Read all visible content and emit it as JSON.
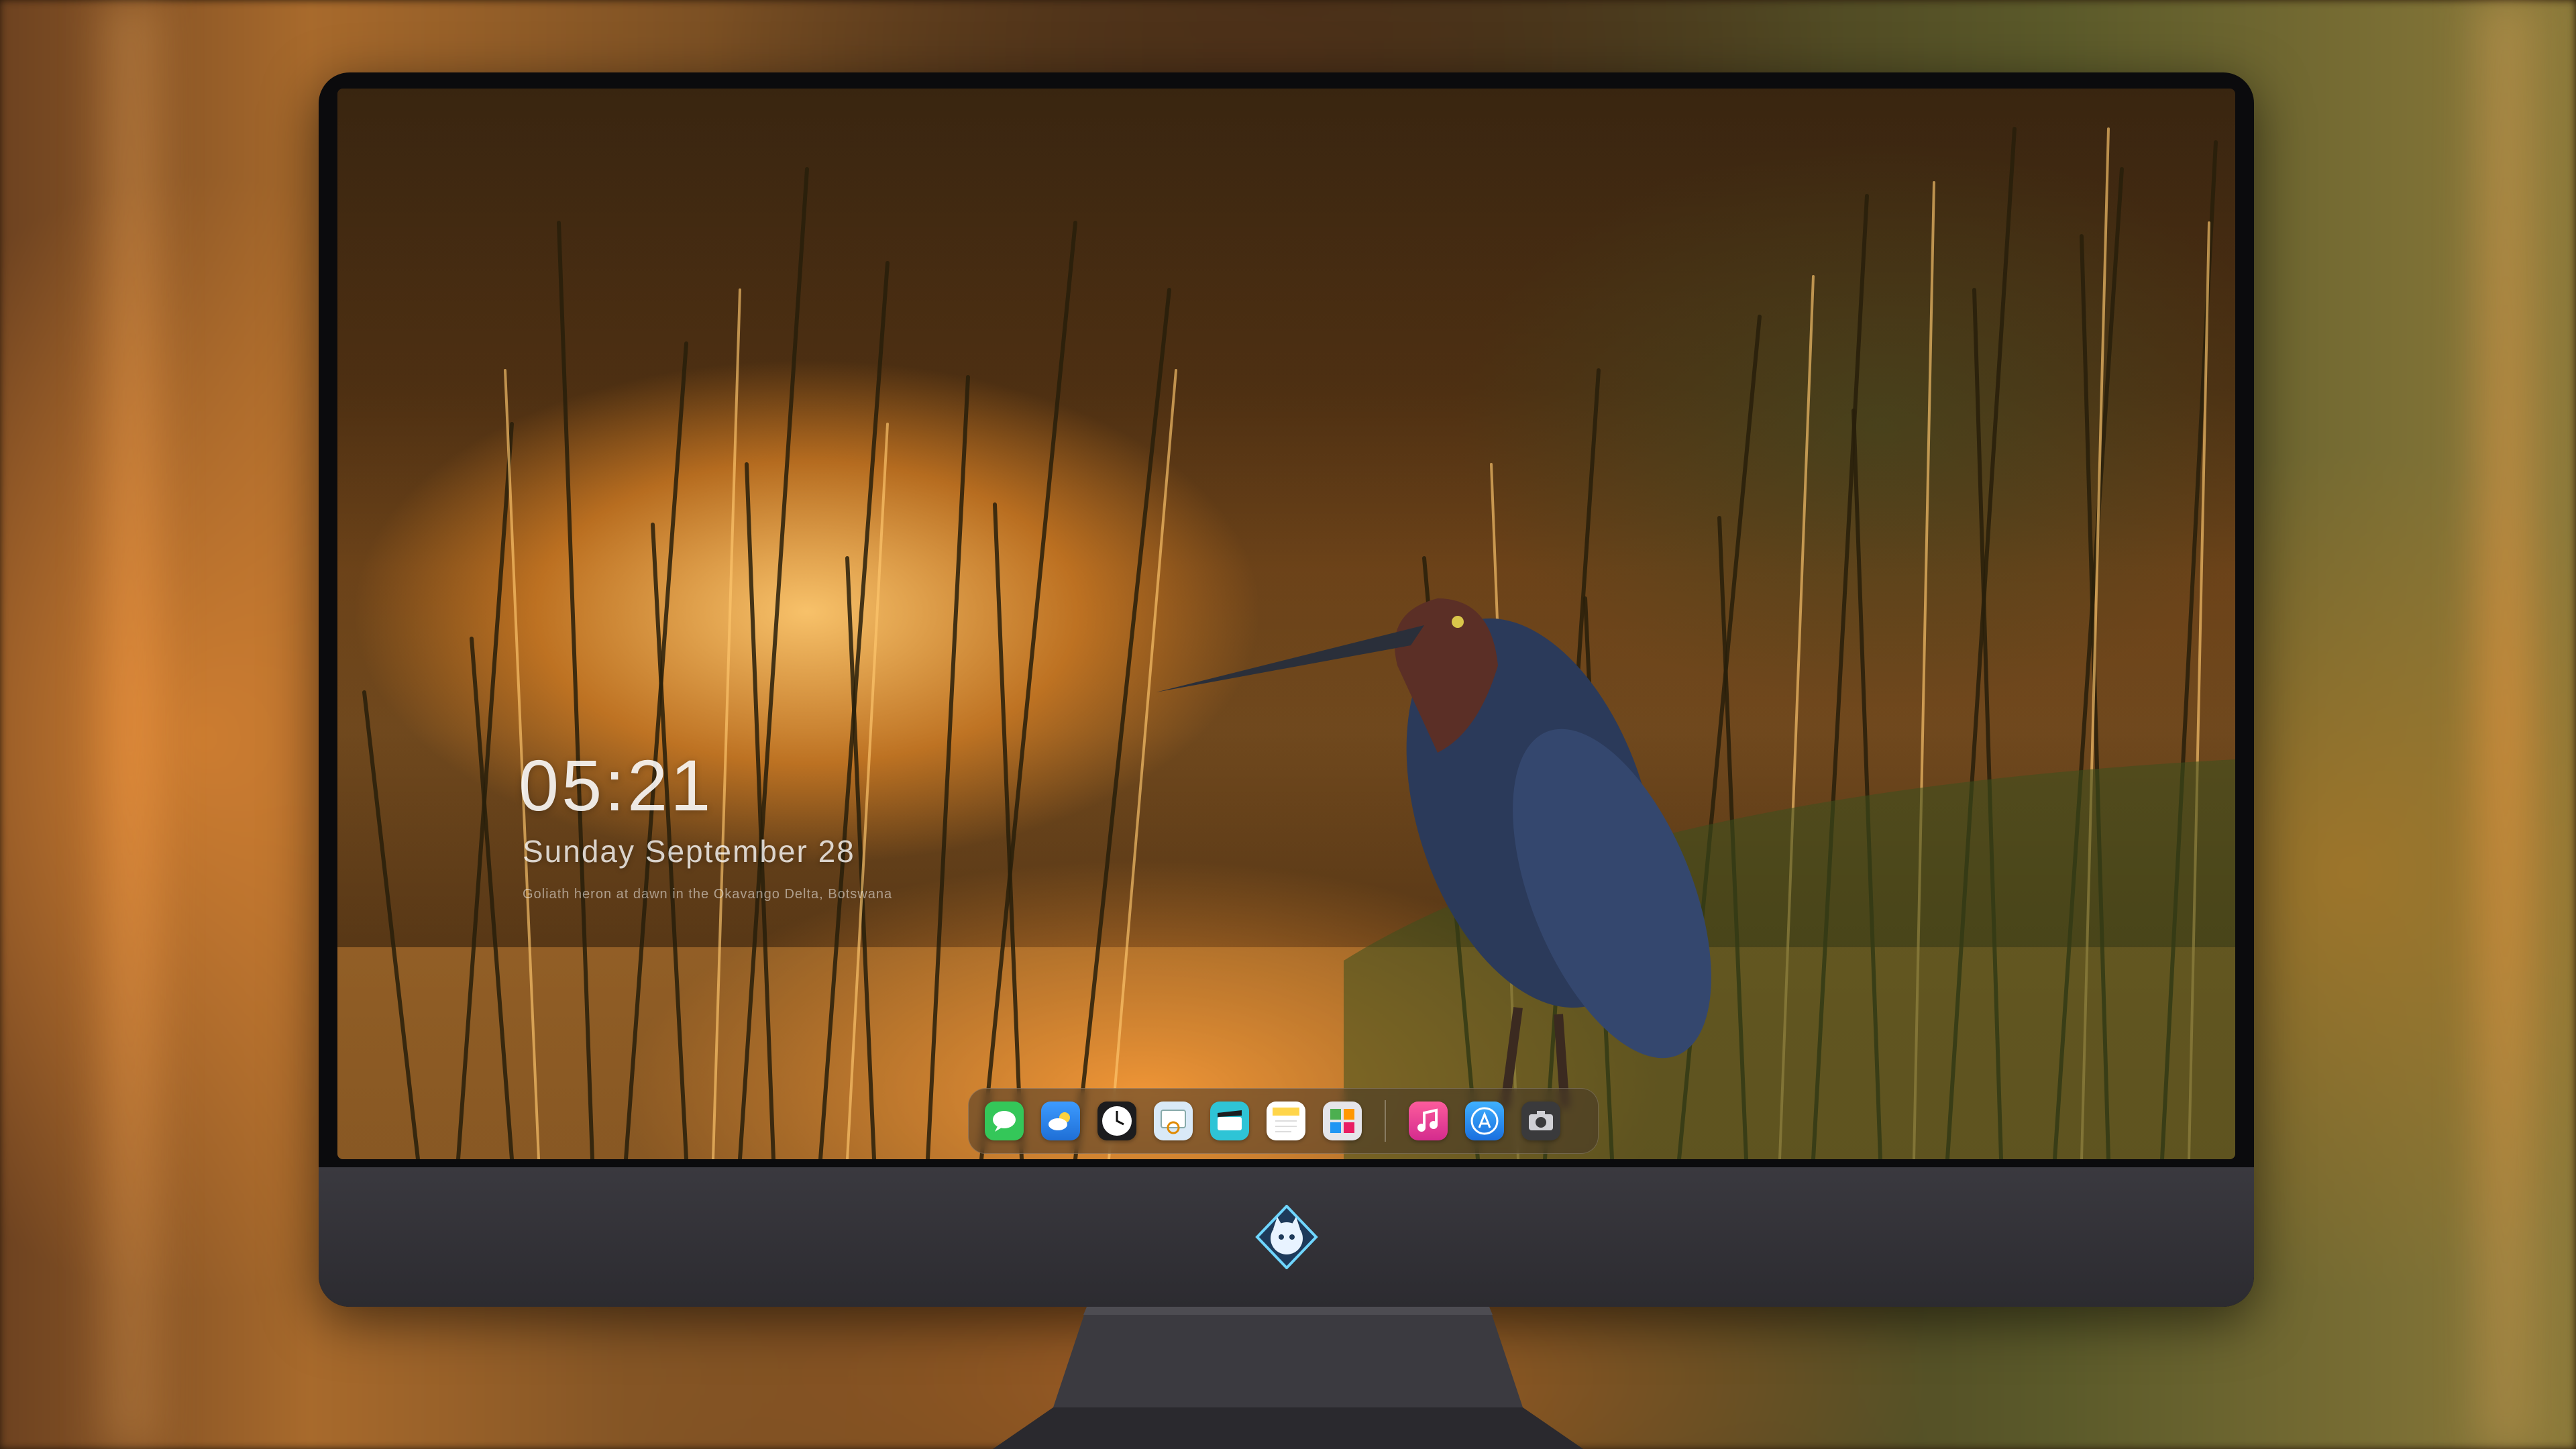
{
  "lock_screen": {
    "time": "05:21",
    "date": "Sunday September 28",
    "caption": "Goliath heron at dawn in the Okavango Delta, Botswana"
  },
  "dock": {
    "apps": [
      {
        "name": "Messages",
        "icon": "messages-icon",
        "color": "#34c759"
      },
      {
        "name": "Weather",
        "icon": "weather-icon",
        "color": "#2f8cf0"
      },
      {
        "name": "Clock",
        "icon": "clock-icon",
        "color": "#1c1c1e"
      },
      {
        "name": "Preview",
        "icon": "preview-icon",
        "color": "#d9e9f7"
      },
      {
        "name": "Clips",
        "icon": "clips-icon",
        "color": "#2ec4d6"
      },
      {
        "name": "Notes",
        "icon": "notes-icon",
        "color": "#ffd54a"
      },
      {
        "name": "Photo Booth",
        "icon": "photo-booth-icon",
        "color": "#e5e5ea"
      },
      {
        "name": "Music",
        "icon": "music-icon",
        "color": "#fc3c9a"
      },
      {
        "name": "App Store",
        "icon": "app-store-icon",
        "color": "#1a8cff"
      },
      {
        "name": "Screenshot",
        "icon": "camera-icon",
        "color": "#3a3a3c"
      }
    ]
  },
  "device": {
    "logo": "cat-logo-icon",
    "bezel_color": "#0b0b0d",
    "chin_color": "#2f2e33"
  }
}
